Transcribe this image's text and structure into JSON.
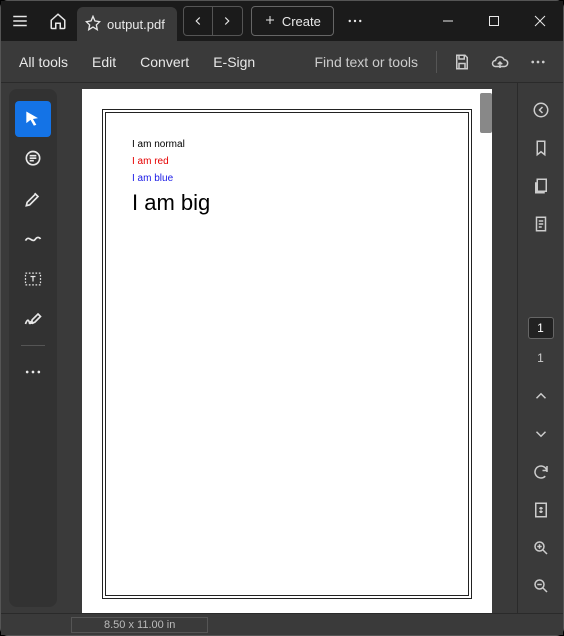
{
  "titlebar": {
    "filename": "output.pdf",
    "create_label": "Create"
  },
  "menubar": {
    "all_tools": "All tools",
    "edit": "Edit",
    "convert": "Convert",
    "esign": "E-Sign",
    "find_placeholder": "Find text or tools"
  },
  "doc": {
    "line1": "I am normal",
    "line2": "I am red",
    "line3": "I am blue",
    "line4": "I am big"
  },
  "right": {
    "current_page": "1",
    "total_pages": "1"
  },
  "status": {
    "dims": "8.50 x 11.00 in"
  }
}
